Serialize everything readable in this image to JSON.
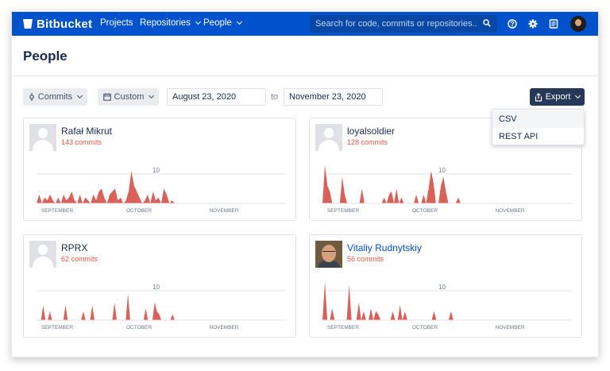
{
  "brand": {
    "name": "Bitbucket",
    "accent": "#0052cc"
  },
  "nav": {
    "items": [
      {
        "label": "Projects",
        "has_menu": false
      },
      {
        "label": "Repositories",
        "has_menu": true
      },
      {
        "label": "People",
        "has_menu": true
      }
    ],
    "search_placeholder": "Search for code, commits or repositories...",
    "icons": [
      "help-icon",
      "settings-icon",
      "notes-icon",
      "user-avatar"
    ]
  },
  "page": {
    "title": "People"
  },
  "filters": {
    "metric": "Commits",
    "range": "Custom",
    "from": "August 23, 2020",
    "to_label": "to",
    "to": "November 23, 2020",
    "export_label": "Export"
  },
  "export_menu": {
    "items": [
      "CSV",
      "REST API"
    ],
    "highlighted": "CSV"
  },
  "chart_axis": {
    "months": [
      "SEPTEMBER",
      "OCTOBER",
      "NOVEMBER"
    ],
    "ref_value": "10",
    "ymax": 14
  },
  "people": [
    {
      "name": "Rafał Mikrut",
      "commits": "143 commits",
      "avatar": "default",
      "chart_data": {
        "type": "area",
        "series": [
          0,
          3,
          0,
          2,
          1,
          3,
          1,
          0,
          2,
          0,
          3,
          1,
          2,
          4,
          1,
          0,
          3,
          0,
          2,
          1,
          0,
          3,
          1,
          4,
          5,
          2,
          0,
          3,
          4,
          5,
          1,
          2,
          0,
          1,
          4,
          11,
          6,
          4,
          2,
          0,
          1,
          3,
          0,
          4,
          1,
          2,
          0,
          5,
          3,
          0,
          1,
          0
        ],
        "ylim": [
          0,
          14
        ]
      }
    },
    {
      "name": "loyalsoldier",
      "commits": "128 commits",
      "avatar": "default",
      "chart_data": {
        "type": "area",
        "series": [
          0,
          13,
          6,
          4,
          0,
          0,
          0,
          0,
          9,
          3,
          0,
          0,
          0,
          0,
          0,
          0,
          5,
          0,
          0,
          0,
          0,
          0,
          0,
          0,
          0,
          2,
          0,
          3,
          4,
          0,
          5,
          0,
          2,
          0,
          0,
          0,
          0,
          0,
          3,
          0,
          0,
          3,
          0,
          5,
          11,
          7,
          0,
          0,
          6,
          9,
          4,
          0,
          0,
          0,
          0,
          2,
          0
        ],
        "ylim": [
          0,
          14
        ]
      }
    },
    {
      "name": "RPRX",
      "commits": "62 commits",
      "avatar": "default",
      "chart_data": {
        "type": "area",
        "series": [
          0,
          0,
          0,
          5,
          0,
          0,
          3,
          0,
          0,
          0,
          0,
          0,
          0,
          5,
          0,
          0,
          0,
          0,
          0,
          0,
          0,
          3,
          0,
          0,
          0,
          5,
          0,
          0,
          0,
          0,
          0,
          0,
          0,
          0,
          0,
          6,
          0,
          0,
          0,
          0,
          0,
          9,
          0,
          0,
          0,
          0,
          0,
          0,
          0,
          4,
          0,
          0,
          0,
          6,
          3,
          2,
          0,
          0,
          0,
          0,
          0,
          2,
          0
        ],
        "ylim": [
          0,
          14
        ]
      }
    },
    {
      "name": "Vitaliy Rudnytskiy",
      "commits": "56 commits",
      "avatar": "photo",
      "chart_data": {
        "type": "area",
        "series": [
          0,
          13,
          0,
          0,
          4,
          0,
          0,
          0,
          0,
          0,
          0,
          12,
          0,
          0,
          0,
          6,
          0,
          3,
          0,
          0,
          4,
          0,
          3,
          2,
          0,
          0,
          0,
          0,
          0,
          3,
          0,
          0,
          5,
          0,
          3,
          0,
          0,
          0,
          0,
          0,
          0,
          0,
          0,
          0,
          0,
          0,
          3,
          0,
          0,
          0,
          0,
          0,
          0,
          3,
          0,
          0,
          0,
          0
        ],
        "ylim": [
          0,
          14
        ]
      }
    }
  ]
}
